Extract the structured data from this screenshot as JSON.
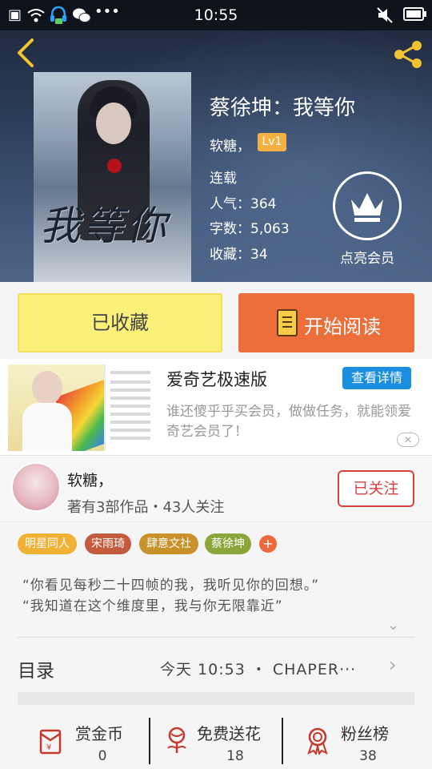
{
  "status_bar": {
    "time": "10:55"
  },
  "book": {
    "title": "蔡徐坤：我等你",
    "cover_title": "我等你",
    "author": "软糖，",
    "level": "Lv1",
    "status": "连载",
    "popularity": "人气：364",
    "word_count": "字数：5,063",
    "favorites": "收藏：34",
    "vip_label": "点亮会员"
  },
  "actions": {
    "saved_label": "已收藏",
    "read_label": "开始阅读"
  },
  "ad": {
    "title": "爱奇艺极速版",
    "detail_label": "查看详情",
    "description": "谁还傻乎乎买会员，做做任务，就能领爱奇艺会员了！",
    "close_label": "✕"
  },
  "author_info": {
    "name": "软糖，",
    "stats": "著有3部作品・43人关注",
    "follow_label": "已关注"
  },
  "tags": [
    {
      "label": "明星同人",
      "color": "#f0b136"
    },
    {
      "label": "宋雨琦",
      "color": "#c45a3e"
    },
    {
      "label": "肆意文社",
      "color": "#c9912a"
    },
    {
      "label": "蔡徐坤",
      "color": "#8aa63a"
    }
  ],
  "quotes": [
    "“你看见每秒二十四帧的我，我听见你的回想。”",
    "“我知道在这个维度里，我与你无限靠近”"
  ],
  "toc": {
    "label": "目录",
    "latest": "今天 10:53 ・ CHAPER···"
  },
  "bottom_stats": [
    {
      "label": "赏金币",
      "value": "0"
    },
    {
      "label": "免费送花",
      "value": "18"
    },
    {
      "label": "粉丝榜",
      "value": "38"
    }
  ],
  "colors": {
    "accent_orange": "#ec6e3b",
    "saved_yellow": "#fbf07a",
    "follow_red": "#d8423c",
    "ad_blue": "#1b8ee0"
  }
}
